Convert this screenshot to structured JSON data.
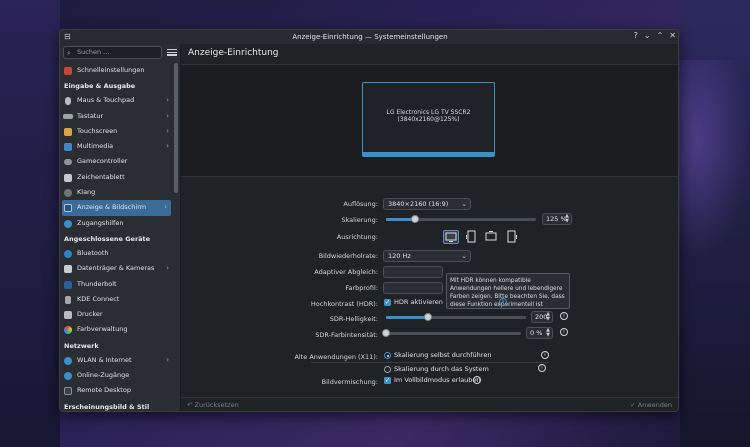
{
  "window": {
    "title": "Anzeige-Einrichtung — Systemeinstellungen"
  },
  "sidebar": {
    "search_placeholder": "Suchen ...",
    "quick": {
      "label": "Schnelleinstellungen"
    },
    "sections": [
      {
        "title": "Eingabe & Ausgabe",
        "items": [
          {
            "label": "Maus & Touchpad",
            "icon": "mouse-icon",
            "chevron": true
          },
          {
            "label": "Tastatur",
            "icon": "keyboard-icon",
            "chevron": true
          },
          {
            "label": "Touchscreen",
            "icon": "touchscreen-icon",
            "chevron": true
          },
          {
            "label": "Multimedia",
            "icon": "multimedia-icon",
            "chevron": true
          },
          {
            "label": "Gamecontroller",
            "icon": "gamepad-icon",
            "chevron": false
          },
          {
            "label": "Zeichentablett",
            "icon": "tablet-icon",
            "chevron": false
          },
          {
            "label": "Klang",
            "icon": "speaker-icon",
            "chevron": false
          },
          {
            "label": "Anzeige & Bildschirm",
            "icon": "display-icon",
            "chevron": true,
            "selected": true
          },
          {
            "label": "Zugangshilfen",
            "icon": "accessibility-icon",
            "chevron": false
          }
        ]
      },
      {
        "title": "Angeschlossene Geräte",
        "items": [
          {
            "label": "Bluetooth",
            "icon": "bluetooth-icon",
            "chevron": false
          },
          {
            "label": "Datenträger & Kameras",
            "icon": "drive-icon",
            "chevron": true
          },
          {
            "label": "Thunderbolt",
            "icon": "thunderbolt-icon",
            "chevron": false
          },
          {
            "label": "KDE Connect",
            "icon": "kde-connect-icon",
            "chevron": false
          },
          {
            "label": "Drucker",
            "icon": "printer-icon",
            "chevron": false
          },
          {
            "label": "Farbverwaltung",
            "icon": "color-icon",
            "chevron": false
          }
        ]
      },
      {
        "title": "Netzwerk",
        "items": [
          {
            "label": "WLAN & Internet",
            "icon": "wifi-icon",
            "chevron": true
          },
          {
            "label": "Online-Zugänge",
            "icon": "online-accounts-icon",
            "chevron": false
          },
          {
            "label": "Remote Desktop",
            "icon": "remote-desktop-icon",
            "chevron": false
          }
        ]
      },
      {
        "title": "Erscheinungsbild & Stil",
        "items": []
      }
    ]
  },
  "main": {
    "title": "Anzeige-Einrichtung",
    "monitor": {
      "name": "LG Electronics LG TV SSCR2",
      "mode": "(3840x2160@125%)"
    },
    "resolution": {
      "label": "Auflösung:",
      "value": "3840×2160 (16:9)"
    },
    "scale": {
      "label": "Skalierung:",
      "value": "125 %",
      "level": 0.19
    },
    "orientation": {
      "label": "Ausrichtung:"
    },
    "refresh": {
      "label": "Bildwiederholrate:",
      "value": "120 Hz"
    },
    "adaptive": {
      "label": "Adaptiver Abgleich:"
    },
    "profile": {
      "label": "Farbprofil:"
    },
    "hdr_tooltip": "Mit HDR können kompatible Anwendungen hellere und lebendigere Farben zeigen. Bitte beachten Sie, dass diese Funktion experimentell ist",
    "hdr": {
      "label": "Hochkontrast (HDR):",
      "checkbox": "HDR aktivieren"
    },
    "sdr_brightness": {
      "label": "SDR-Helligkeit:",
      "value": "200",
      "level": 0.3
    },
    "sdr_gamut": {
      "label": "SDR-Farbintensität:",
      "value": "0 %",
      "level": 0.0
    },
    "legacy": {
      "label": "Alte Anwendungen (X11):",
      "opt1": "Skalierung selbst durchführen",
      "opt2": "Skalierung durch das System"
    },
    "tearing": {
      "label": "Bildvermischung:",
      "checkbox": "Im Vollbildmodus erlauben"
    },
    "reset_label": "Zurücksetzen",
    "apply_label": "Anwenden"
  }
}
